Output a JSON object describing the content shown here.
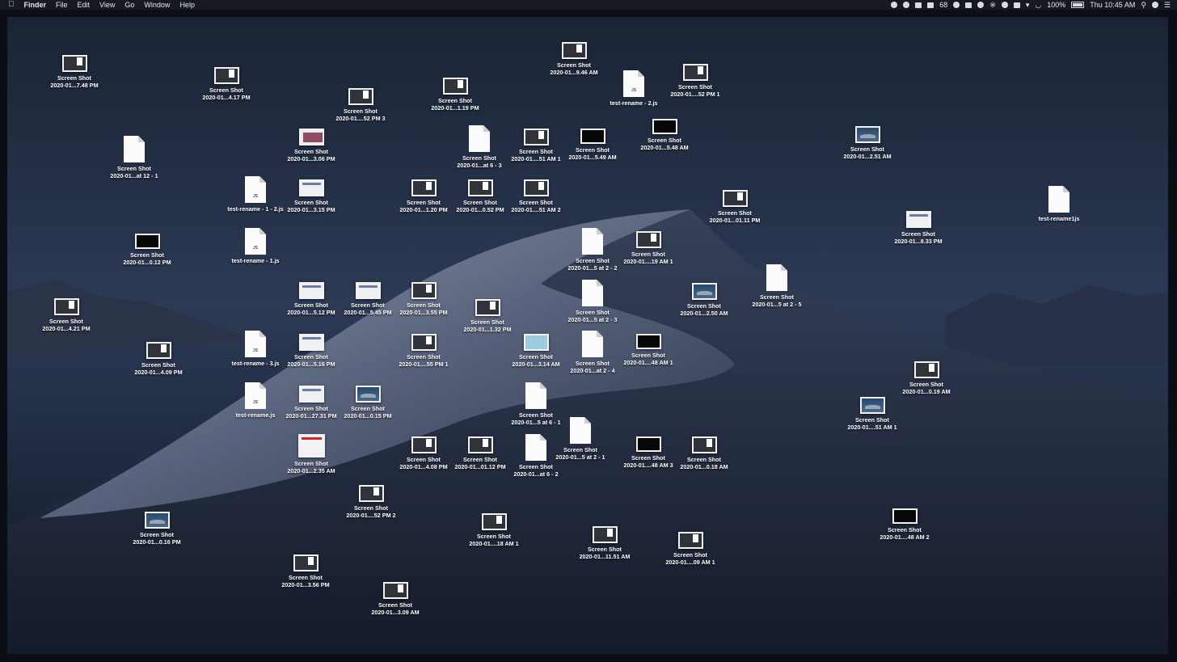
{
  "menubar": {
    "app_name": "Finder",
    "menus": [
      "File",
      "Edit",
      "View",
      "Go",
      "Window",
      "Help"
    ],
    "status": {
      "badge_count": "68",
      "battery": "100%",
      "clock": "Thu 10:45 AM"
    },
    "icons": [
      "apple-icon",
      "record-icon",
      "nav-icon",
      "dropbox-icon",
      "cloud-icon",
      "notification-count-icon",
      "clock-icon",
      "grid-icon",
      "circle-icon",
      "bluetooth-icon",
      "bell-icon",
      "screen-icon",
      "volume-icon",
      "wifi-icon",
      "battery-icon",
      "spotlight-icon",
      "siri-icon",
      "menu-icon"
    ]
  },
  "desktop": {
    "icons": [
      {
        "name": "Screen Shot",
        "sub": "2020-01...7.48 PM",
        "kind": "screenshot"
      },
      {
        "name": "Screen Shot",
        "sub": "2020-01...4.17 PM",
        "kind": "screenshot"
      },
      {
        "name": "Screen Shot",
        "sub": "2020-01....52 PM 3",
        "kind": "screenshot"
      },
      {
        "name": "Screen Shot",
        "sub": "2020-01...1.19 PM",
        "kind": "screenshot"
      },
      {
        "name": "Screen Shot",
        "sub": "2020-01...9.46 AM",
        "kind": "screenshot"
      },
      {
        "name": "test-rename - 2.js",
        "sub": "",
        "kind": "js"
      },
      {
        "name": "Screen Shot",
        "sub": "2020-01....52 PM 1",
        "kind": "screenshot"
      },
      {
        "name": "Screen Shot",
        "sub": "2020-01...at 12 - 1",
        "kind": "file"
      },
      {
        "name": "Screen Shot",
        "sub": "2020-01...3.06 PM",
        "kind": "pink"
      },
      {
        "name": "Screen Shot",
        "sub": "2020-01...at 6 - 3",
        "kind": "file"
      },
      {
        "name": "Screen Shot",
        "sub": "2020-01....51 AM 1",
        "kind": "screenshot"
      },
      {
        "name": "Screen Shot",
        "sub": "2020-01...5.49 AM",
        "kind": "dark"
      },
      {
        "name": "Screen Shot",
        "sub": "2020-01...5.48 AM",
        "kind": "dark"
      },
      {
        "name": "Screen Shot",
        "sub": "2020-01...2.51 AM",
        "kind": "sky"
      },
      {
        "name": "test-rename - 1 - 2.js",
        "sub": "",
        "kind": "js"
      },
      {
        "name": "Screen Shot",
        "sub": "2020-01...3.15 PM",
        "kind": "doc"
      },
      {
        "name": "Screen Shot",
        "sub": "2020-01...1.20 PM",
        "kind": "screenshot"
      },
      {
        "name": "Screen Shot",
        "sub": "2020-01...0.52 PM",
        "kind": "screenshot"
      },
      {
        "name": "Screen Shot",
        "sub": "2020-01....51 AM 2",
        "kind": "screenshot"
      },
      {
        "name": "Screen Shot",
        "sub": "2020-01...01.11 PM",
        "kind": "screenshot"
      },
      {
        "name": "Screen Shot",
        "sub": "2020-01...8.33 PM",
        "kind": "doc"
      },
      {
        "name": "test-rename1js",
        "sub": "",
        "kind": "file"
      },
      {
        "name": "Screen Shot",
        "sub": "2020-01...0.12 PM",
        "kind": "dark"
      },
      {
        "name": "test-rename - 1.js",
        "sub": "",
        "kind": "js"
      },
      {
        "name": "Screen Shot",
        "sub": "2020-01...5 at 2 - 2",
        "kind": "file"
      },
      {
        "name": "Screen Shot",
        "sub": "2020-01....19 AM 1",
        "kind": "screenshot"
      },
      {
        "name": "Screen Shot",
        "sub": "2020-01...5.12 PM",
        "kind": "doc"
      },
      {
        "name": "Screen Shot",
        "sub": "2020-01...5.45 PM",
        "kind": "doc"
      },
      {
        "name": "Screen Shot",
        "sub": "2020-01...3.55 PM",
        "kind": "screenshot"
      },
      {
        "name": "Screen Shot",
        "sub": "2020-01...1.32 PM",
        "kind": "screenshot"
      },
      {
        "name": "Screen Shot",
        "sub": "2020-01...5 at 2 - 3",
        "kind": "file"
      },
      {
        "name": "Screen Shot",
        "sub": "2020-01...2.50 AM",
        "kind": "sky"
      },
      {
        "name": "Screen Shot",
        "sub": "2020-01...5 at 2 - 5",
        "kind": "file"
      },
      {
        "name": "Screen Shot",
        "sub": "2020-01...4.21 PM",
        "kind": "screenshot"
      },
      {
        "name": "Screen Shot",
        "sub": "2020-01...4.09 PM",
        "kind": "screenshot"
      },
      {
        "name": "test-rename - 3.js",
        "sub": "",
        "kind": "js"
      },
      {
        "name": "Screen Shot",
        "sub": "2020-01...5.16 PM",
        "kind": "doc"
      },
      {
        "name": "Screen Shot",
        "sub": "2020-01....55 PM 1",
        "kind": "screenshot"
      },
      {
        "name": "Screen Shot",
        "sub": "2020-01...3.14 AM",
        "kind": "light"
      },
      {
        "name": "Screen Shot",
        "sub": "2020-01...at 2 - 4",
        "kind": "file"
      },
      {
        "name": "Screen Shot",
        "sub": "2020-01....48 AM 1",
        "kind": "dark"
      },
      {
        "name": "Screen Shot",
        "sub": "2020-01...0.19 AM",
        "kind": "screenshot"
      },
      {
        "name": "test-rename.js",
        "sub": "",
        "kind": "js"
      },
      {
        "name": "Screen Shot",
        "sub": "2020-01...27.31 PM",
        "kind": "doc"
      },
      {
        "name": "Screen Shot",
        "sub": "2020-01...0.15 PM",
        "kind": "sky"
      },
      {
        "name": "Screen Shot",
        "sub": "2020-01...5 at 6 - 1",
        "kind": "file"
      },
      {
        "name": "Screen Shot",
        "sub": "2020-01....51 AM 1",
        "kind": "sky"
      },
      {
        "name": "Screen Shot",
        "sub": "2020-01...5 at 2 - 1",
        "kind": "file"
      },
      {
        "name": "Screen Shot",
        "sub": "2020-01...2.35 AM",
        "kind": "red"
      },
      {
        "name": "Screen Shot",
        "sub": "2020-01...4.08 PM",
        "kind": "screenshot"
      },
      {
        "name": "Screen Shot",
        "sub": "2020-01...01.12 PM",
        "kind": "screenshot"
      },
      {
        "name": "Screen Shot",
        "sub": "2020-01...at 6 - 2",
        "kind": "file"
      },
      {
        "name": "Screen Shot",
        "sub": "2020-01....48 AM 3",
        "kind": "dark"
      },
      {
        "name": "Screen Shot",
        "sub": "2020-01...0.18 AM",
        "kind": "screenshot"
      },
      {
        "name": "Screen Shot",
        "sub": "2020-01....52 PM 2",
        "kind": "screenshot"
      },
      {
        "name": "Screen Shot",
        "sub": "2020-01...0.16 PM",
        "kind": "sky"
      },
      {
        "name": "Screen Shot",
        "sub": "2020-01....18 AM 1",
        "kind": "screenshot"
      },
      {
        "name": "Screen Shot",
        "sub": "2020-01...11.51 AM",
        "kind": "screenshot"
      },
      {
        "name": "Screen Shot",
        "sub": "2020-01....09 AM 1",
        "kind": "screenshot"
      },
      {
        "name": "Screen Shot",
        "sub": "2020-01....48 AM 2",
        "kind": "dark"
      },
      {
        "name": "Screen Shot",
        "sub": "2020-01...3.56 PM",
        "kind": "screenshot"
      },
      {
        "name": "Screen Shot",
        "sub": "2020-01...3.09 AM",
        "kind": "screenshot"
      }
    ]
  }
}
